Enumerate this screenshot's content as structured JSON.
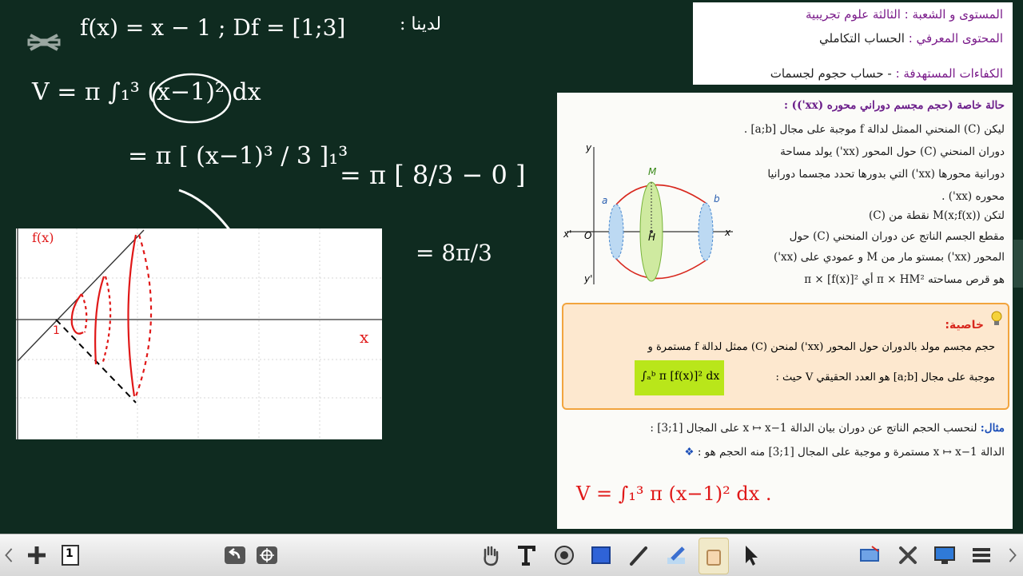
{
  "header": {
    "level_label": "المستوى و الشعبة :",
    "level_value": "الثالثة علوم تجريبية",
    "content_label": "المحتوى المعرفي :",
    "content_value": "الحساب التكاملي",
    "skills_label": "الكفاءات المستهدفة :",
    "skills_value": "- حساب حجوم لجسمات"
  },
  "board": {
    "given": "لدينا :",
    "function_def": "f(x) = x − 1 ; Df = [1;3]",
    "volume_formula": "V = π ∫₁³ (x−1)² dx",
    "antiderivative": "= π [ (x−1)³ / 3 ]₁³",
    "evaluation": "= π [ 8/3 − 0 ]",
    "result": "= 8π/3",
    "plot_ylabel": "f(x)",
    "plot_xlabel": "x",
    "plot_tick": "1"
  },
  "lesson": {
    "case_title": "حالة خاصة (حجم مجسم دوراني محوره (xx')) :",
    "lines": [
      "ليكن (C) المنحني الممثل لدالة f موجبة على مجال [a;b] .",
      "دوران المنحني (C) حول المحور (xx') يولد مساحة",
      "دورانية محورها (xx') التي بدورها تحدد مجسما دورانيا",
      "محوره (xx') .",
      "لتكن M(x;f(x)) نقطة من (C)",
      "مقطع الجسم الناتج عن دوران المنحني (C) حول",
      "المحور (xx') بمستو مار من M و عمودي على (xx')",
      "هو قرص مساحته π × HM² أي π × [f(x)]²"
    ],
    "figure_labels": {
      "y": "y",
      "yprime": "y'",
      "x": "x",
      "xprime": "x'",
      "O": "O",
      "M": "M",
      "H": "H",
      "a": "a",
      "b": "b"
    },
    "property_title": "خاصية:",
    "property_line1": "حجم مجسم مولد بالدوران حول المحور (xx') لمنحن (C) ممثل لدالة f مستمرة و",
    "property_line2": "موجبة على مجال [a;b] هو العدد الحقيقي V حيث :",
    "property_integral": "∫ₐᵇ π [f(x)]² dx",
    "example_title": "مثال:",
    "example_line1": "لنحسب الحجم الناتج عن دوران بيان الدالة x ↦ x−1 على المجال [1;3] :",
    "example_line2": "الدالة x ↦ x−1 مستمرة و موجبة على المجال [1;3] منه الحجم هو :",
    "example_answer": "V = ∫₁³ π (x−1)² dx ."
  },
  "toolbar": {
    "page_number": "1",
    "icons": [
      "chevron-left-icon",
      "add-page-icon",
      "page-icon",
      "undo-icon",
      "target-icon",
      "hand-icon",
      "text-icon",
      "spotlight-icon",
      "rectangle-icon",
      "pen-icon",
      "highlighter-icon",
      "eraser-icon",
      "pointer-icon",
      "screen-capture-icon",
      "tools-icon",
      "display-icon",
      "menu-icon",
      "chevron-right-icon"
    ]
  },
  "colors": {
    "board": "#0f2b20",
    "chalk": "#ffffff",
    "accent_red": "#e01818",
    "header_purple": "#7a1b8a",
    "property_orange": "#f2a43e",
    "integral_green": "#b9e61a"
  }
}
